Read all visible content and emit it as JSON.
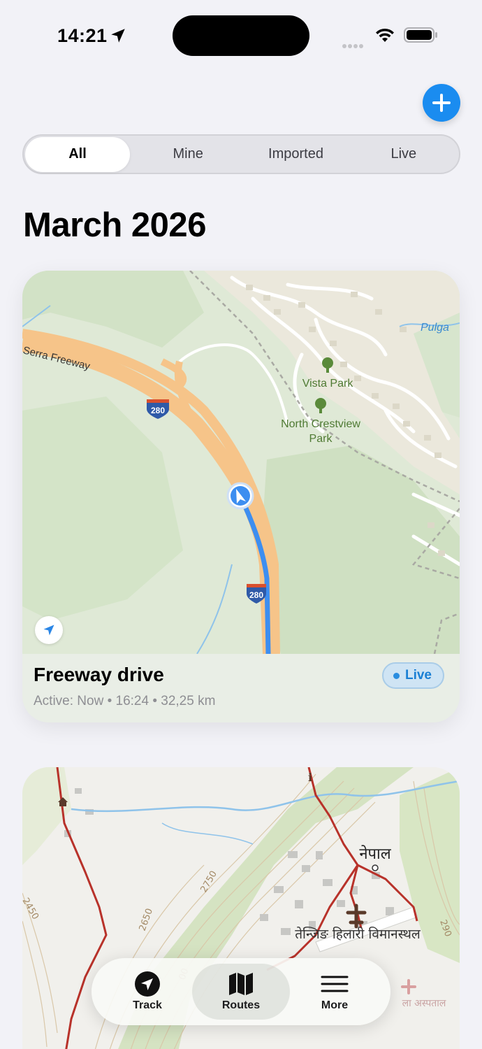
{
  "status_bar": {
    "time": "14:21",
    "icons": [
      "location-arrow-icon",
      "signal-icon",
      "wifi-icon",
      "battery-icon"
    ]
  },
  "header": {
    "add_icon": "plus-icon",
    "accent_color": "#1a8cf0"
  },
  "filter": {
    "segments": [
      "All",
      "Mine",
      "Imported",
      "Live"
    ],
    "selected": "All"
  },
  "section": {
    "title": "March 2026"
  },
  "route_card": {
    "title": "Freeway drive",
    "meta": "Active: Now • 16:24 • 32,25 km",
    "badge": "Live",
    "map_labels": {
      "road": "Serra Freeway",
      "shield_1": "280",
      "shield_2": "280",
      "park_1": "Vista Park",
      "park_2_line1": "North Crestview",
      "park_2_line2": "Park",
      "place_edge": "Pulga"
    }
  },
  "route_card_2": {
    "map_labels": {
      "town": "नेपाल",
      "airport": "तेन्जिङ हिलारी विमानस्थल",
      "hospital": "ला अस्पताल",
      "contour_1": "2450",
      "contour_2": "2650",
      "contour_3": "2750",
      "contour_4": "290",
      "contour_5": "00"
    }
  },
  "tab_bar": {
    "tabs": [
      {
        "label": "Track",
        "icon": "location-arrow-icon"
      },
      {
        "label": "Routes",
        "icon": "map-icon"
      },
      {
        "label": "More",
        "icon": "menu-icon"
      }
    ],
    "selected": "Routes"
  }
}
